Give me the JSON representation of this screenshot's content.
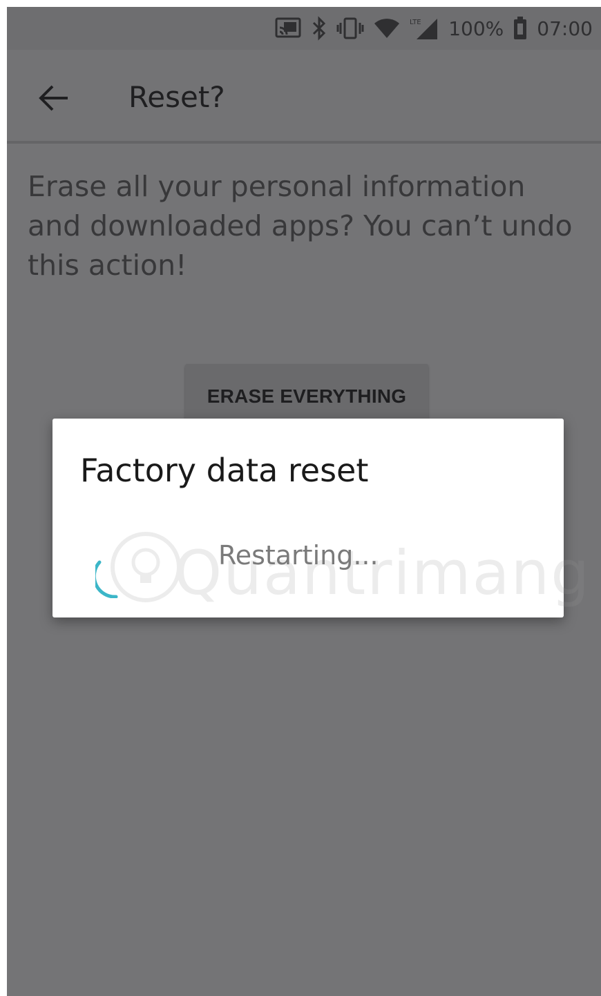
{
  "status_bar": {
    "battery_percent": "100%",
    "time": "07:00",
    "icons": [
      "cast-icon",
      "bluetooth-icon",
      "vibrate-icon",
      "wifi-icon",
      "lte-signal-icon",
      "battery-icon"
    ]
  },
  "app_bar": {
    "back_icon": "arrow-left-icon",
    "title": "Reset?"
  },
  "main": {
    "description": "Erase all your personal information and downloaded apps? You can’t undo this action!",
    "erase_button_label": "ERASE EVERYTHING"
  },
  "dialog": {
    "title": "Factory data reset",
    "message": "Restarting...",
    "spinner_color": "#3cb6c8"
  },
  "watermark": {
    "text": "Quantrimang",
    "icon": "lightbulb-icon"
  },
  "colors": {
    "scrim_background": "#747476",
    "dialog_background": "#ffffff",
    "accent": "#3cb6c8"
  }
}
